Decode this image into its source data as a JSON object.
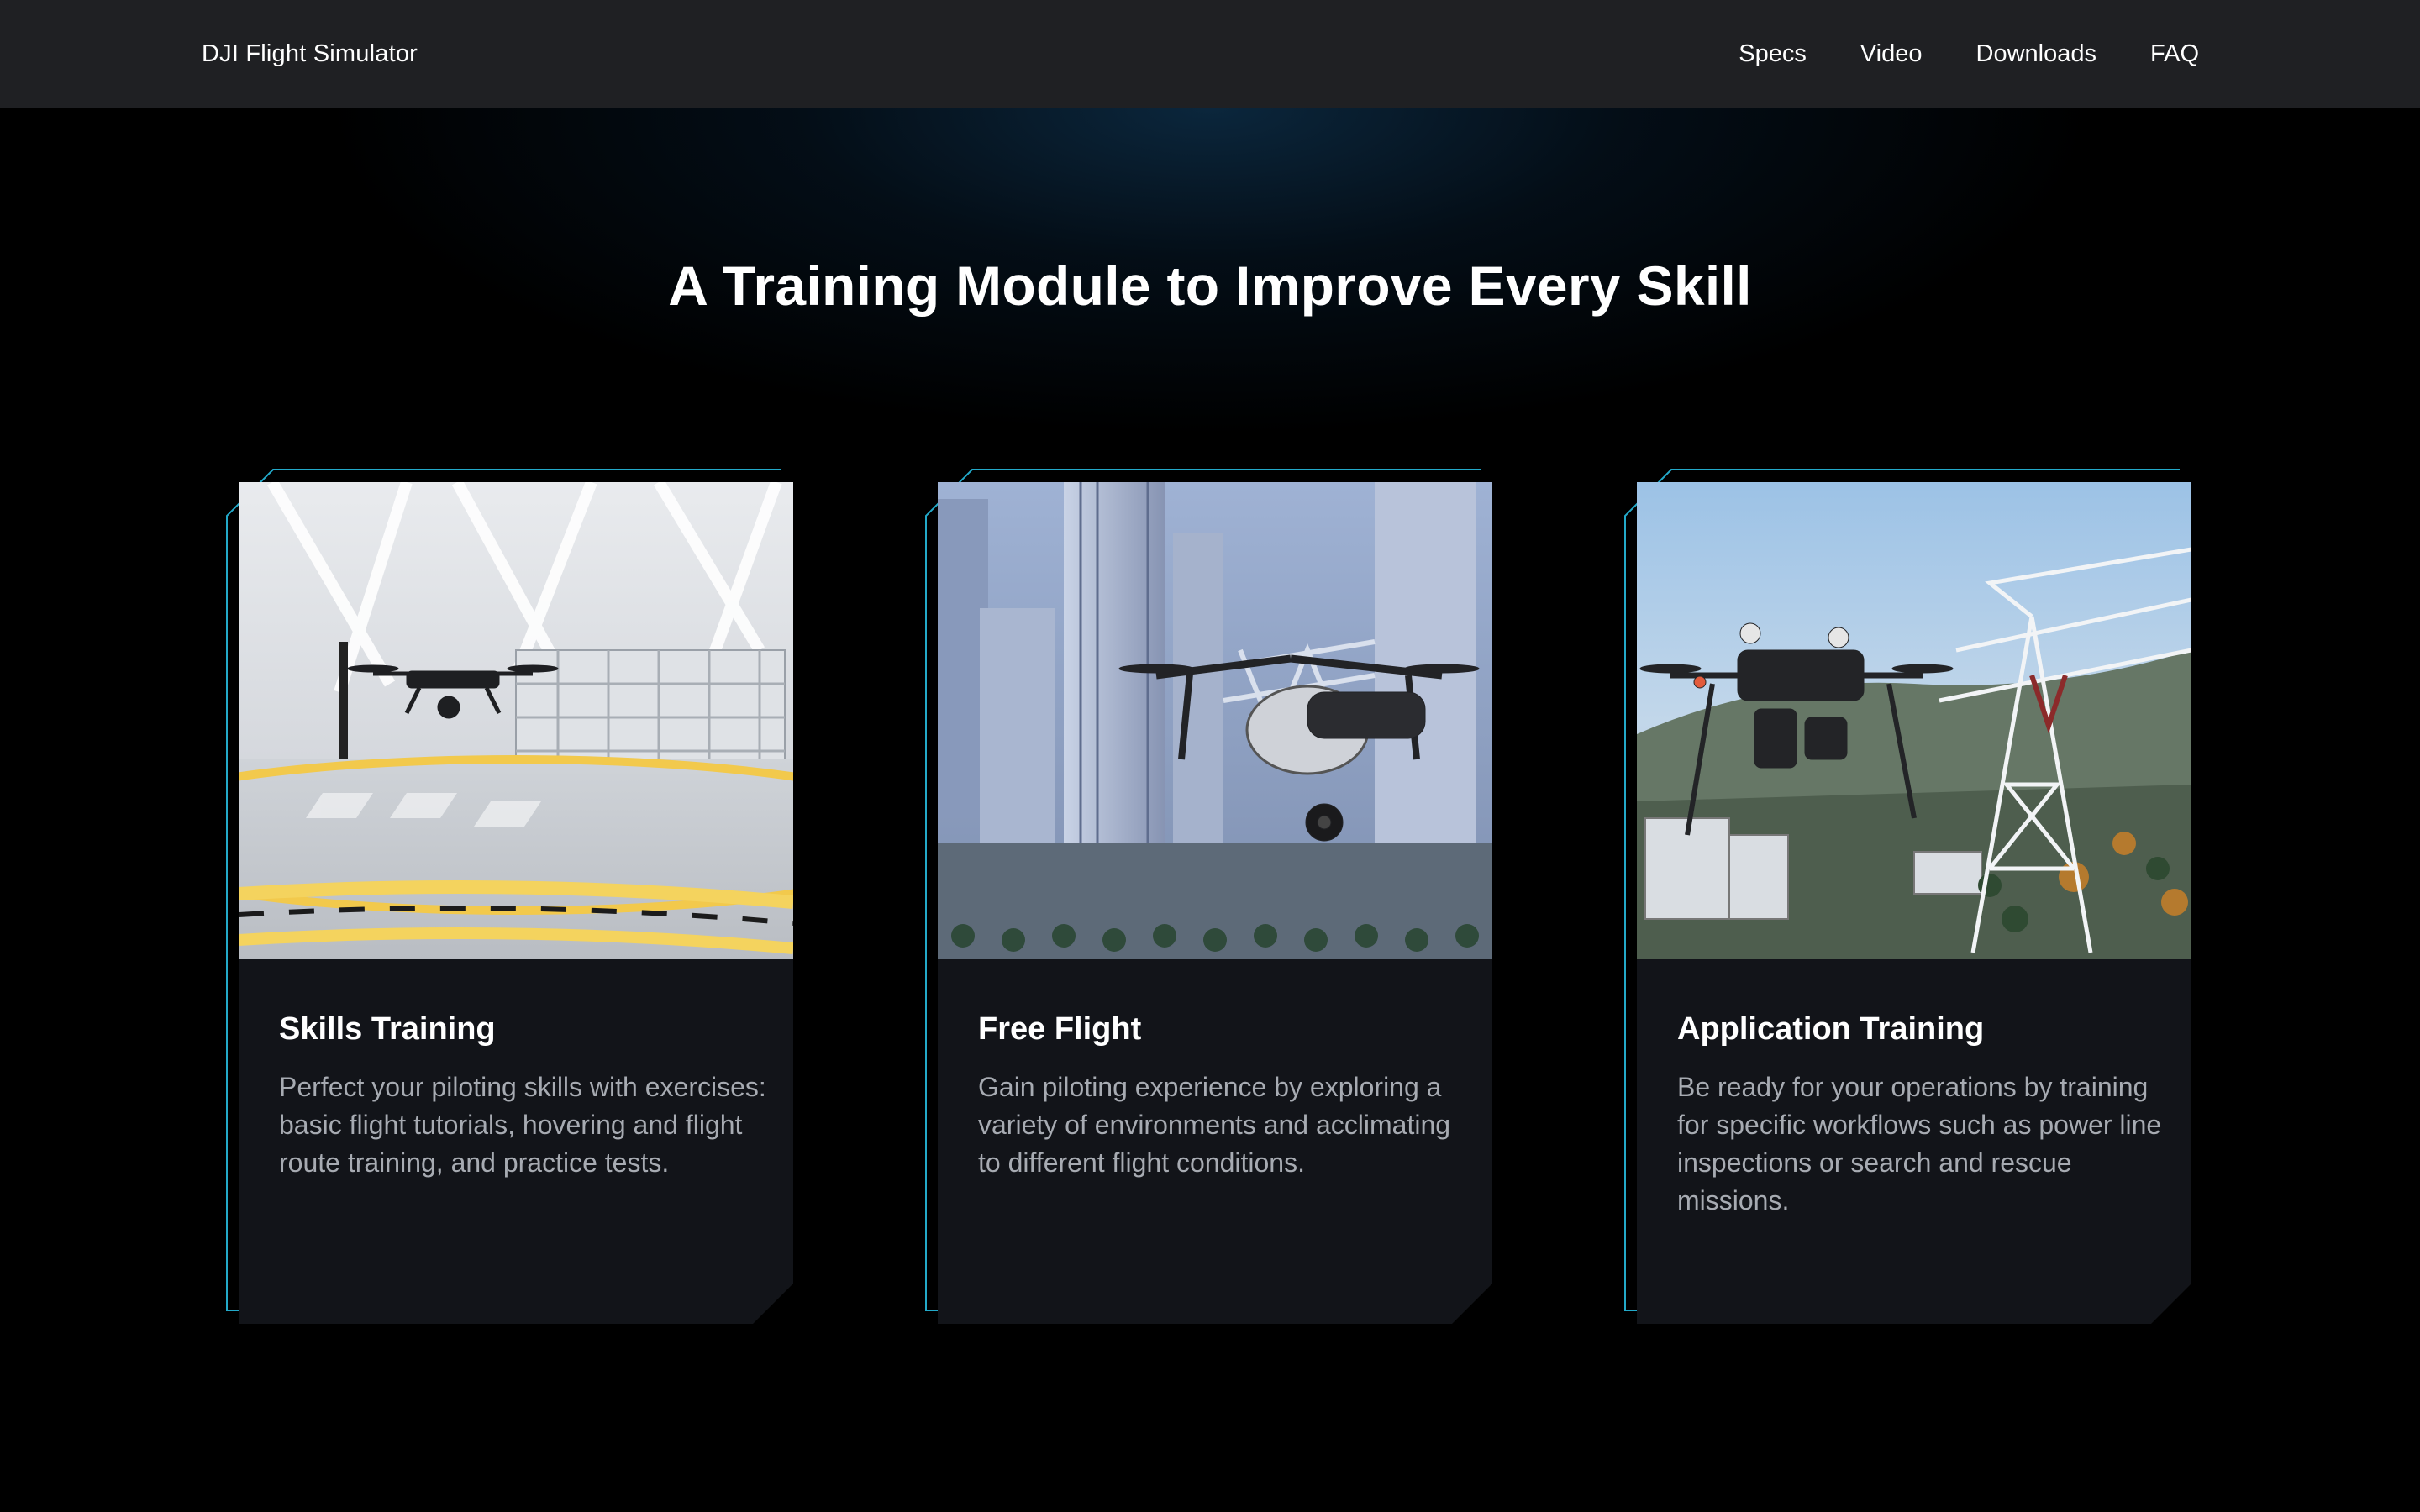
{
  "navbar": {
    "brand": "DJI Flight Simulator",
    "links": [
      "Specs",
      "Video",
      "Downloads",
      "FAQ"
    ]
  },
  "section": {
    "headline": "A Training Module to Improve Every Skill"
  },
  "cards": [
    {
      "title": "Skills Training",
      "description": "Perfect your piloting skills with exercises: basic flight tutorials, hovering and flight route training, and practice tests."
    },
    {
      "title": "Free Flight",
      "description": "Gain piloting experience by exploring a variety of environments and acclimating to different flight conditions."
    },
    {
      "title": "Application Training",
      "description": "Be ready for your operations by training for specific workflows such as power line inspections or search and rescue missions."
    }
  ],
  "colors": {
    "navbar_bg": "#1f2023",
    "card_bg": "#121419",
    "accent_frame": "#23a9c9",
    "text_secondary": "#a7abb2"
  }
}
